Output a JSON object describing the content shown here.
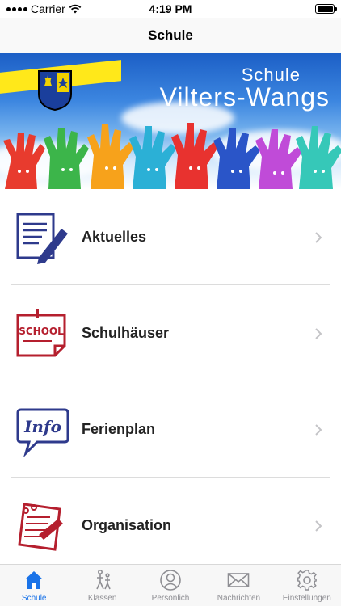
{
  "status_bar": {
    "carrier": "Carrier",
    "time": "4:19 PM"
  },
  "nav": {
    "title": "Schule"
  },
  "banner": {
    "title_top": "Schule",
    "title_main": "Vilters-Wangs"
  },
  "menu": {
    "items": [
      {
        "label": "Aktuelles",
        "icon": "notepad-pencil-icon"
      },
      {
        "label": "Schulhäuser",
        "icon": "school-note-icon"
      },
      {
        "label": "Ferienplan",
        "icon": "info-bubble-icon"
      },
      {
        "label": "Organisation",
        "icon": "notebook-icon"
      }
    ]
  },
  "tabs": [
    {
      "label": "Schule",
      "icon": "house-icon",
      "active": true
    },
    {
      "label": "Klassen",
      "icon": "walking-people-icon",
      "active": false
    },
    {
      "label": "Persönlich",
      "icon": "person-circle-icon",
      "active": false
    },
    {
      "label": "Nachrichten",
      "icon": "envelope-icon",
      "active": false
    },
    {
      "label": "Einstellungen",
      "icon": "gear-icon",
      "active": false
    }
  ],
  "colors": {
    "accent": "#1a73e8",
    "icon_blue": "#2e3a8c",
    "icon_red": "#b51f2e",
    "separator": "#dcdcdc"
  }
}
